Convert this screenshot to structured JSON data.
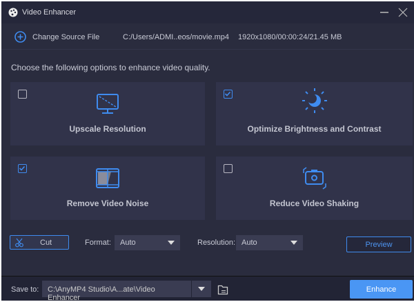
{
  "window": {
    "title": "Video Enhancer",
    "minimize_icon": "minimize-icon",
    "close_icon": "close-icon"
  },
  "source": {
    "change_label": "Change Source File",
    "path": "C:/Users/ADMI..eos/movie.mp4",
    "info": "1920x1080/00:00:24/21.45 MB"
  },
  "intro": "Choose the following options to enhance video quality.",
  "options": [
    {
      "label": "Upscale Resolution",
      "checked": false,
      "icon": "monitor-icon"
    },
    {
      "label": "Optimize Brightness and Contrast",
      "checked": true,
      "icon": "brightness-icon"
    },
    {
      "label": "Remove Video Noise",
      "checked": true,
      "icon": "film-icon"
    },
    {
      "label": "Reduce Video Shaking",
      "checked": false,
      "icon": "camera-stabilize-icon"
    }
  ],
  "controls": {
    "cut_label": "Cut",
    "format_label": "Format:",
    "format_value": "Auto",
    "resolution_label": "Resolution:",
    "resolution_value": "Auto",
    "preview_label": "Preview"
  },
  "bottom": {
    "save_label": "Save to:",
    "save_path": "C:\\AnyMP4 Studio\\A...ate\\Video Enhancer",
    "enhance_label": "Enhance"
  },
  "colors": {
    "accent": "#3f8cf0",
    "background": "#2a2c3e",
    "card": "#31334a"
  }
}
